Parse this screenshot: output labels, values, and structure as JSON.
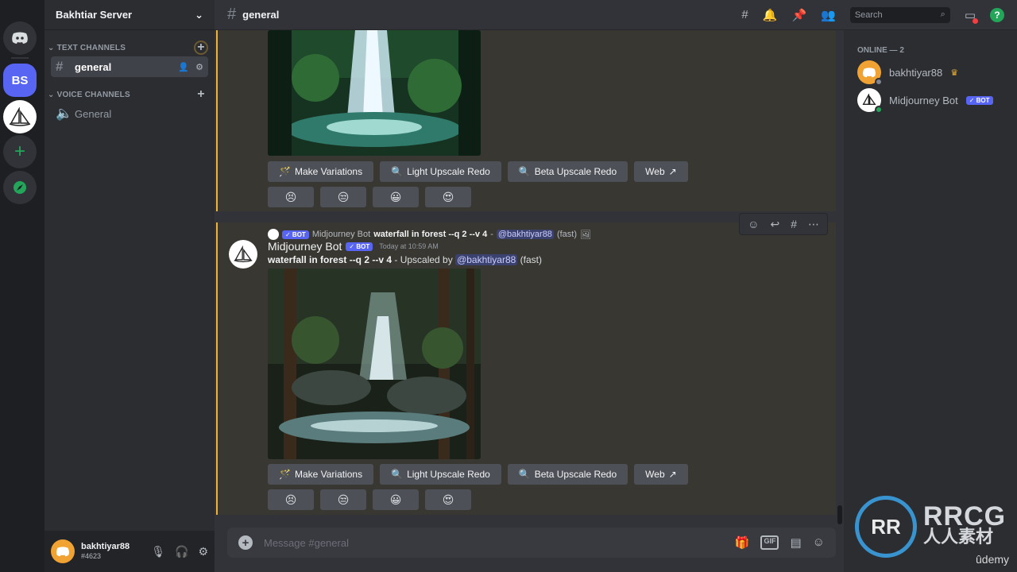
{
  "server": {
    "name": "Bakhtiar Server",
    "icon_label": "BS"
  },
  "rail": {
    "icons": [
      "discord-home-icon",
      "server-bs",
      "midjourney-server-icon",
      "add-server-icon",
      "explore-icon"
    ]
  },
  "channels": {
    "text_category": "TEXT CHANNELS",
    "voice_category": "VOICE CHANNELS",
    "text": [
      {
        "name": "general",
        "active": true
      }
    ],
    "voice": [
      {
        "name": "General"
      }
    ]
  },
  "user": {
    "name": "bakhtiyar88",
    "tag": "#4623"
  },
  "topbar": {
    "channel": "general",
    "search_placeholder": "Search",
    "help": "?"
  },
  "buttons": {
    "variations": "Make Variations",
    "light_upscale": "Light Upscale Redo",
    "beta_upscale": "Beta Upscale Redo",
    "web": "Web"
  },
  "reactions": [
    "😣",
    "😒",
    "😀",
    "😍"
  ],
  "message2": {
    "reply": {
      "badge": "✓ BOT",
      "author": "Midjourney Bot",
      "prompt": "waterfall in forest --q 2 --v 4",
      "separator": " - ",
      "mention": "@bakhtiyar88",
      "speed": "(fast)"
    },
    "author": "Midjourney Bot",
    "badge": "✓ BOT",
    "time": "Today at 10:59 AM",
    "prompt": "waterfall in forest --q 2 --v 4",
    "upscaled_by": " - Upscaled by ",
    "mention": "@bakhtiyar88",
    "speed": "(fast)"
  },
  "composer": {
    "placeholder": "Message #general",
    "gif": "GIF"
  },
  "members": {
    "heading": "ONLINE — 2",
    "list": [
      {
        "name": "bakhtiyar88",
        "crown": "♛",
        "status": "idle"
      },
      {
        "name": "Midjourney Bot",
        "badge": "✓ BOT",
        "status": "online"
      }
    ]
  },
  "watermark": {
    "line1": "RRCG",
    "line2": "人人素材",
    "logo": "RR"
  },
  "udemy": "ûdemy",
  "colors": {
    "accent": "#5865f2",
    "highlight_border": "#f0b232",
    "online": "#23a55a"
  }
}
